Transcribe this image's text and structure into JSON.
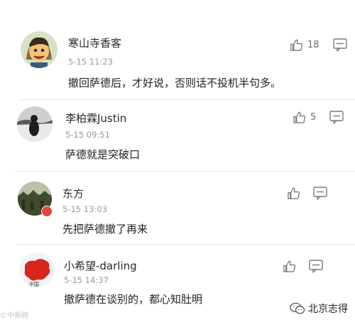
{
  "comments": [
    {
      "username": "寒山寺香客",
      "timestamp": "5-15 11:23",
      "text": "撤回萨德后，才好说，否则话不投机半句多。",
      "likes": "18",
      "avatar_icon": "cartoon-man-avatar"
    },
    {
      "username": "李柏霖Justin",
      "timestamp": "5-15 09:51",
      "text": "萨德就是突破口",
      "likes": "5",
      "avatar_icon": "bw-photo-avatar"
    },
    {
      "username": "东方",
      "timestamp": "5-15 13:03",
      "text": "先把萨德撤了再来",
      "likes": "",
      "avatar_icon": "landscape-avatar"
    },
    {
      "username": "小希望-darling",
      "timestamp": "5-15 14:37",
      "text": "撤萨德在谈别的，都心知肚明",
      "likes": "",
      "avatar_icon": "china-map-avatar"
    }
  ],
  "icons": {
    "like": "thumbs-up-icon",
    "reply": "comment-icon",
    "watermark": "wechat-icon"
  },
  "watermark": {
    "left_text": "©中新网",
    "right_text": "北京志得"
  },
  "colors": {
    "text": "#1f1f1f",
    "meta": "#9a9a9a",
    "badge": "#e0463b"
  }
}
